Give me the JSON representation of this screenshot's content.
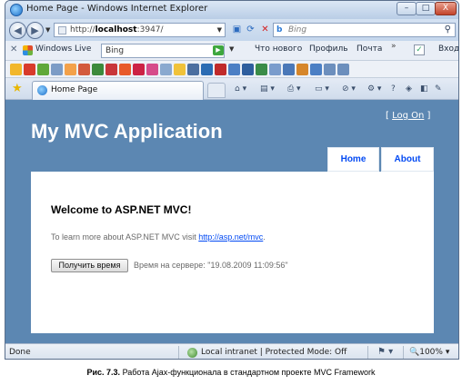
{
  "window": {
    "title": "Home Page - Windows Internet Explorer",
    "minimize": "–",
    "maximize": "□",
    "close": "X"
  },
  "address_bar": {
    "url_prefix": "http://",
    "url_host": "localhost",
    "url_rest": ":3947/",
    "search_placeholder": "Bing"
  },
  "live_bar": {
    "label": "Windows Live",
    "search_value": "Bing",
    "links": [
      "Что нового",
      "Профиль",
      "Почта"
    ],
    "more": "»",
    "signin": "Вход"
  },
  "tab": {
    "label": "Home Page"
  },
  "page": {
    "header_title": "My MVC Application",
    "logon_open": "[ ",
    "logon_link": "Log On",
    "logon_close": " ]",
    "menu": [
      "Home",
      "About"
    ],
    "welcome": "Welcome to ASP.NET MVC!",
    "learn_text": "To learn more about ASP.NET MVC visit ",
    "learn_link": "http://asp.net/mvc",
    "learn_end": ".",
    "time_button": "Получить время",
    "server_time": "Время на сервере: \"19.08.2009 11:09:56\""
  },
  "status_bar": {
    "text": "Done",
    "zone": "Local intranet | Protected Mode: Off",
    "zoom": "100%"
  },
  "caption": {
    "label": "Рис. 7.3.",
    "text": " Работа Ajax-функционала в стандартном проекте MVC Framework"
  },
  "colors": {
    "page_bg": "#5c87b2",
    "link": "#034af3",
    "window_frame": "#b9cde6"
  }
}
